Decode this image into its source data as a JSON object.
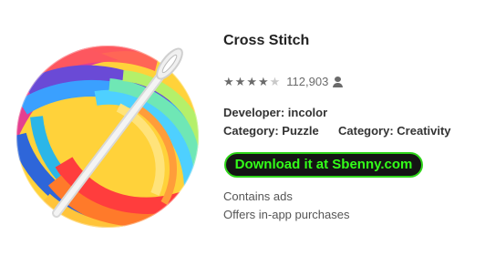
{
  "app": {
    "title": "Cross Stitch",
    "rating": {
      "stars": 4.5,
      "count": "112,903"
    },
    "developer": "Developer: incolor",
    "category_primary": "Category: Puzzle",
    "category_secondary": "Category: Creativity",
    "download_label": "Download it at Sbenny.com",
    "notes": [
      "Contains ads",
      "Offers in-app purchases"
    ]
  },
  "icons": {
    "app_icon": "yarn-ball-with-needle-icon",
    "rating_icon": "star-icon",
    "user_icon": "person-icon"
  },
  "colors": {
    "button_bg": "#141414",
    "button_text": "#33ff19",
    "button_border": "#2fd51a",
    "star": "#6b6b6b"
  }
}
